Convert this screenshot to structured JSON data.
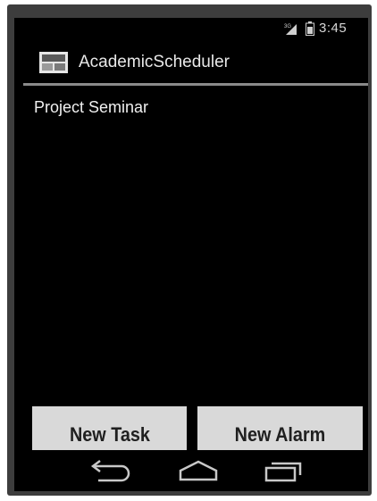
{
  "status_bar": {
    "time": "3:45",
    "icons": [
      "signal-icon",
      "battery-icon"
    ]
  },
  "action_bar": {
    "app_icon": "app-icon",
    "title": "AcademicScheduler"
  },
  "list": {
    "items": [
      "Project Seminar"
    ]
  },
  "buttons": {
    "new_task": "New Task",
    "new_alarm": "New Alarm"
  },
  "nav_bar": {
    "icons": [
      "back-icon",
      "home-icon",
      "recents-icon"
    ]
  },
  "colors": {
    "screen_background": "#000000",
    "frame": "#3d3d3d",
    "button_background": "#d9d9d9",
    "button_text": "#202020",
    "divider": "#8a8a8a"
  }
}
